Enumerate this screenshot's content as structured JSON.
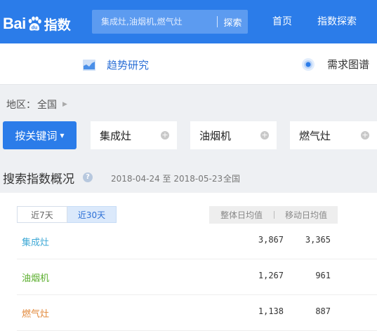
{
  "header": {
    "logo_text": "Bai",
    "logo_suffix": "指数",
    "search": {
      "placeholder": "集成灶,油烟机,燃气灶",
      "button_label": "探索"
    },
    "nav": [
      {
        "label": "首页"
      },
      {
        "label": "指数探索"
      }
    ]
  },
  "subnav": {
    "trend_label": "趋势研究",
    "demand_label": "需求图谱"
  },
  "region": {
    "label": "地区：",
    "value": "全国"
  },
  "keywords": {
    "button_label": "按关键词",
    "items": [
      {
        "label": "集成灶"
      },
      {
        "label": "油烟机"
      },
      {
        "label": "燃气灶"
      }
    ]
  },
  "overview": {
    "title": "搜索指数概况",
    "help": "?",
    "date_range": "2018-04-24 至 2018-05-23",
    "region": "全国",
    "segments": [
      {
        "label": "近7天",
        "active": false
      },
      {
        "label": "近30天",
        "active": true
      }
    ],
    "columns": [
      "整体日均值",
      "移动日均值"
    ],
    "rows": [
      {
        "name": "集成灶",
        "color": "#3fa9d6",
        "overall": "3,867",
        "mobile": "3,365"
      },
      {
        "name": "油烟机",
        "color": "#5aae2c",
        "overall": "1,267",
        "mobile": "961"
      },
      {
        "name": "燃气灶",
        "color": "#e2883a",
        "overall": "1,138",
        "mobile": "887"
      }
    ]
  },
  "colors": {
    "brand": "#2b7ce9",
    "link": "#2b6fd6"
  }
}
